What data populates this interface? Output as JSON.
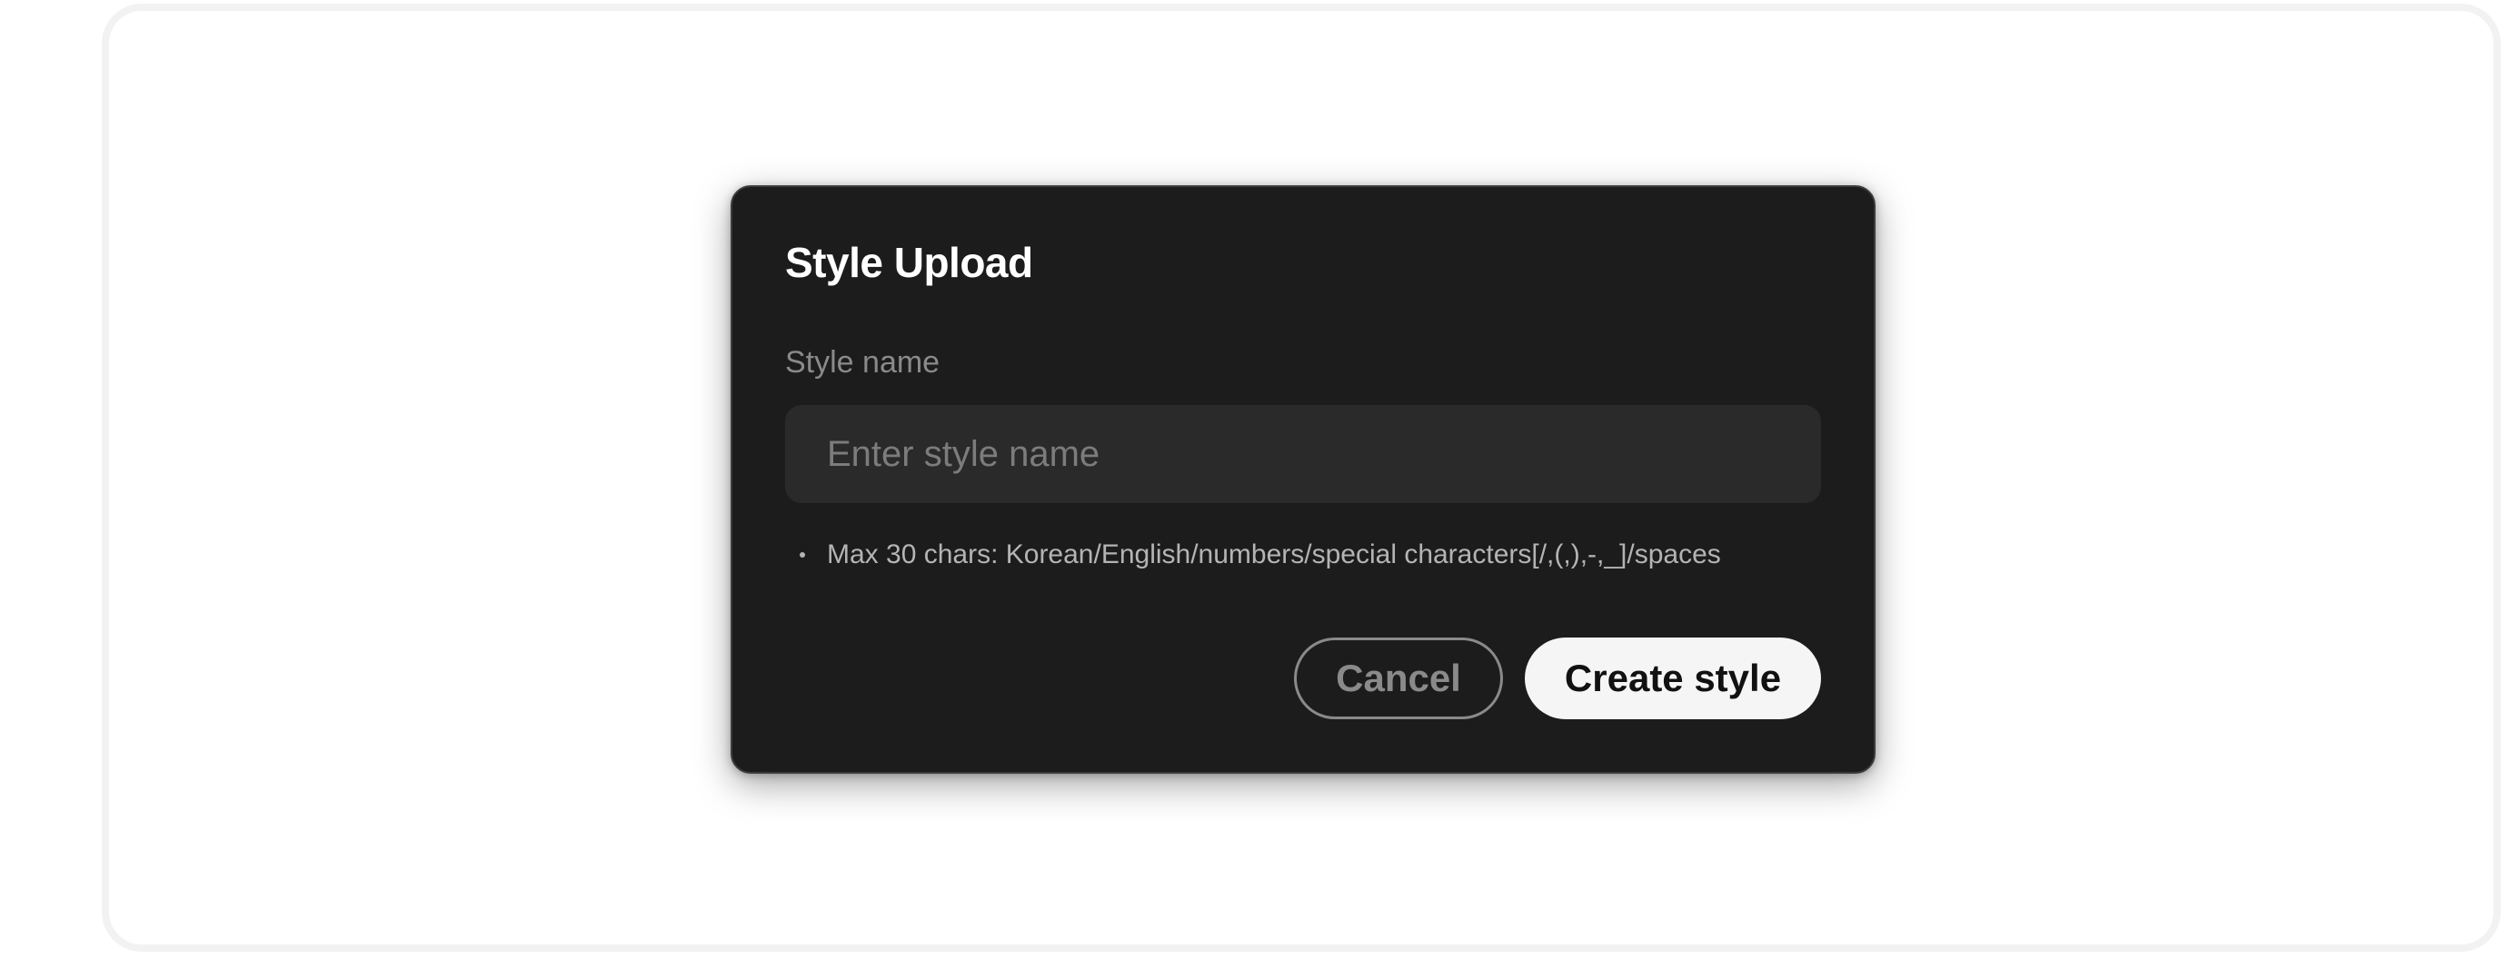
{
  "dialog": {
    "title": "Style Upload",
    "field_label": "Style name",
    "input": {
      "value": "",
      "placeholder": "Enter style name"
    },
    "hint": "Max 30 chars: Korean/English/numbers/special characters[/,(,),-,_]/spaces",
    "buttons": {
      "cancel_label": "Cancel",
      "create_label": "Create style"
    }
  },
  "colors": {
    "modal_background": "#1c1c1c",
    "input_background": "#2a2a2a",
    "primary_button": "#f5f5f5",
    "secondary_text": "#8a8a8a"
  }
}
